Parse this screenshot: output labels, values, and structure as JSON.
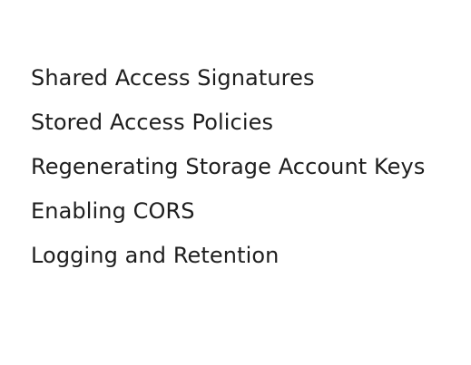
{
  "topics": [
    {
      "label": "Shared Access Signatures"
    },
    {
      "label": "Stored Access Policies"
    },
    {
      "label": "Regenerating Storage Account Keys"
    },
    {
      "label": "Enabling CORS"
    },
    {
      "label": "Logging and Retention"
    }
  ],
  "colors": {
    "background": "#ffffff",
    "text": "#1e1e1e"
  }
}
